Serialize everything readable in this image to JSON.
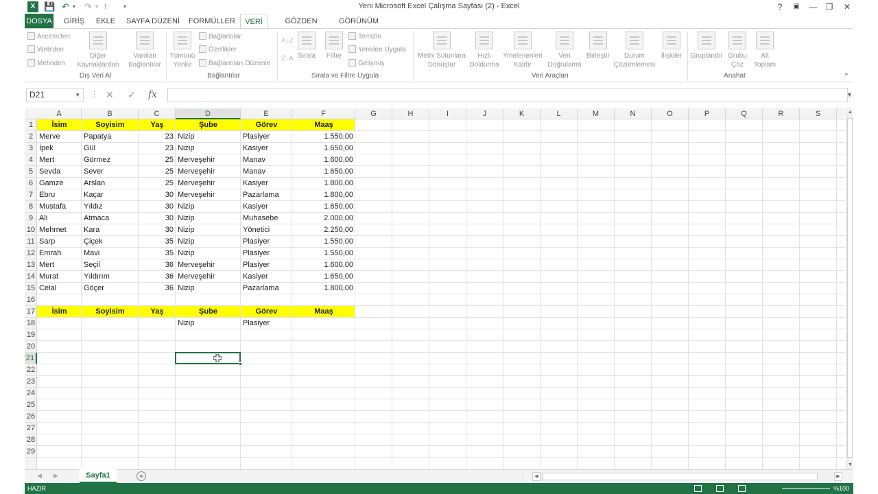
{
  "window": {
    "title": "Yeni Microsoft Excel Çalışma Sayfası (2) - Excel",
    "help": "?",
    "controls": [
      "—",
      "❐",
      "✕"
    ]
  },
  "tabs": {
    "file": "DOSYA",
    "items": [
      "GİRİŞ",
      "EKLE",
      "SAYFA DÜZENİ",
      "FORMÜLLER",
      "VERİ",
      "GÖZDEN GEÇİR",
      "GÖRÜNÜM"
    ],
    "active": "VERİ"
  },
  "ribbon": {
    "external_data": {
      "access": "Access'ten",
      "web": "Web'den",
      "text": "Metinden",
      "other_l1": "Diğer",
      "other_l2": "Kaynaklardan",
      "existing_l1": "Varolan",
      "existing_l2": "Bağlantılar",
      "group": "Dış Veri Al"
    },
    "connections": {
      "refresh_l1": "Tümünü",
      "refresh_l2": "Yenile",
      "connections": "Bağlantılar",
      "properties": "Özellikler",
      "edit_links": "Bağlantıları Düzenle",
      "group": "Bağlantılar"
    },
    "sort_filter": {
      "sort_az": "A↓Z",
      "sort": "Sırala",
      "filter": "Filtre",
      "clear": "Temizle",
      "reapply": "Yeniden Uygula",
      "advanced": "Gelişmiş",
      "group": "Sırala ve Filtre Uygula"
    },
    "data_tools": {
      "text_to_cols_l1": "Metni Sütunlara",
      "text_to_cols_l2": "Dönüştür",
      "flash_l1": "Hızlı",
      "flash_l2": "Doldurma",
      "remove_dup_l1": "Yinelenenleri",
      "remove_dup_l2": "Kaldır",
      "validation_l1": "Veri",
      "validation_l2": "Doğrulama",
      "consolidate": "Birleştir",
      "whatif_l1": "Durum",
      "whatif_l2": "Çözümlemesi",
      "relationships": "İlişkiler",
      "group": "Veri Araçları"
    },
    "outline": {
      "group_btn": "Gruplandır",
      "ungroup_l1": "Grubu",
      "ungroup_l2": "Çöz",
      "subtotal_l1": "Alt",
      "subtotal_l2": "Toplam",
      "group": "Anahat"
    }
  },
  "formula_bar": {
    "name_box": "D21",
    "fx": "fx",
    "value": ""
  },
  "grid": {
    "columns": [
      "A",
      "B",
      "C",
      "D",
      "E",
      "F",
      "G",
      "H",
      "I",
      "J",
      "K",
      "L",
      "M",
      "N",
      "O",
      "P",
      "Q",
      "R",
      "S"
    ],
    "selected_column": "D",
    "rows": [
      "1",
      "2",
      "3",
      "4",
      "5",
      "6",
      "7",
      "8",
      "9",
      "10",
      "11",
      "12",
      "13",
      "14",
      "15",
      "16",
      "17",
      "18",
      "19",
      "20",
      "21",
      "22",
      "23",
      "24",
      "25",
      "26",
      "27",
      "28",
      "29"
    ],
    "selected_row": "21",
    "header": [
      "İsim",
      "Soyisim",
      "Yaş",
      "Şube",
      "Görev",
      "Maaş"
    ],
    "records": [
      [
        "Merve",
        "Papatya",
        "23",
        "Nizip",
        "Plasiyer",
        "1.550,00"
      ],
      [
        "İpek",
        "Gül",
        "23",
        "Nizip",
        "Kasiyer",
        "1.650,00"
      ],
      [
        "Mert",
        "Görmez",
        "25",
        "Merveşehir",
        "Manav",
        "1.600,00"
      ],
      [
        "Sevda",
        "Sever",
        "25",
        "Merveşehir",
        "Manav",
        "1.650,00"
      ],
      [
        "Gamze",
        "Arslan",
        "25",
        "Merveşehir",
        "Kasiyer",
        "1.800,00"
      ],
      [
        "Ebru",
        "Kaçar",
        "30",
        "Merveşehir",
        "Pazarlama",
        "1.800,00"
      ],
      [
        "Mustafa",
        "Yıldız",
        "30",
        "Nizip",
        "Kasiyer",
        "1.650,00"
      ],
      [
        "Ali",
        "Atmaca",
        "30",
        "Nizip",
        "Muhasebe",
        "2.000,00"
      ],
      [
        "Mehmet",
        "Kara",
        "30",
        "Nizip",
        "Yönetici",
        "2.250,00"
      ],
      [
        "Sarp",
        "Çiçek",
        "35",
        "Nizip",
        "Plasiyer",
        "1.550,00"
      ],
      [
        "Emrah",
        "Mavi",
        "35",
        "Nizip",
        "Plasiyer",
        "1.550,00"
      ],
      [
        "Mert",
        "Seçil",
        "36",
        "Merveşehir",
        "Plasiyer",
        "1.600,00"
      ],
      [
        "Murat",
        "Yıldırım",
        "36",
        "Merveşehir",
        "Kasiyer",
        "1.650,00"
      ],
      [
        "Celal",
        "Göçer",
        "36",
        "Nizip",
        "Pazarlama",
        "1.800,00"
      ]
    ],
    "criteria_header": [
      "İsim",
      "Soyisim",
      "Yaş",
      "Şube",
      "Görev",
      "Maaş"
    ],
    "criteria_row": [
      "",
      "",
      "",
      "Nizip",
      "Plasiyer",
      ""
    ],
    "highlight_color": "#ffff00"
  },
  "sheets": {
    "active": "Sayfa1",
    "add": "+"
  },
  "status": {
    "ready": "HAZIR",
    "zoom": "%100"
  },
  "colors": {
    "accent": "#217346"
  }
}
